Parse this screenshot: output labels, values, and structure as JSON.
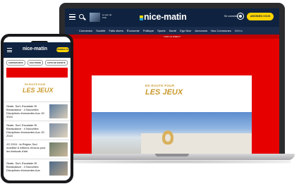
{
  "laptop": {
    "header": {
      "edition_text": "Le jour  de l'info",
      "logo_text": "nice-matin",
      "login_label": "Se connecter",
      "subscribe_label": "ABONNEZ-VOUS"
    },
    "nav_items": [
      "Connexion",
      "Société",
      "Faits divers",
      "Économie",
      "Politique",
      "Sports",
      "Santé",
      "Ego Nice",
      "Annonces",
      "Nos Communes",
      "Météo"
    ],
    "ticker_text": "VOIR LE DIRECT",
    "hero": {
      "logo_small": "EN ROUTE POUR",
      "logo_big": "LES JEUX"
    },
    "colors": {
      "brand_navy": "#0f2340",
      "brand_red": "#e60000",
      "accent_yellow": "#ffd400",
      "gold": "#c99a2c"
    }
  },
  "phone": {
    "logo_text": "nice-matin",
    "subscribe_label": "ABONNEZ-VOUS",
    "chips": [
      "CORONAVIRUS",
      "SOLUTIONS",
      "FAITS DE SOCIÉTÉ"
    ],
    "hero": {
      "logo_small": "EN ROUTE POUR",
      "logo_big": "LES JEUX"
    },
    "articles": [
      {
        "title": "Skate, Surf, Escalade Et Breakdance : 4 Nouvelles Disciplines étonnantes Aux JO 2024"
      },
      {
        "title": "Skate, Surf, Escalade Et Breakdance : 4 Nouvelles Disciplines étonnantes Aux JO 2024"
      },
      {
        "title": "JO 2024 : la Région Sud mobilise 6 millions d'euros pour les festivals d'été"
      },
      {
        "title": "Skate, Surf, Escalade Et Breakdance : 4 Nouvelles Disciplines étonnantes Aux"
      }
    ]
  }
}
